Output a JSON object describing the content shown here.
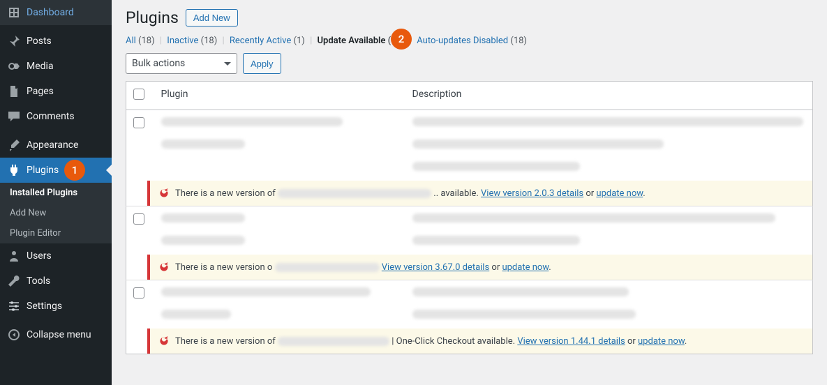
{
  "sidebar": {
    "items": [
      {
        "icon": "dashboard",
        "label": "Dashboard"
      },
      {
        "icon": "pin",
        "label": "Posts"
      },
      {
        "icon": "media",
        "label": "Media"
      },
      {
        "icon": "page",
        "label": "Pages"
      },
      {
        "icon": "comment",
        "label": "Comments"
      },
      {
        "icon": "appearance",
        "label": "Appearance"
      },
      {
        "icon": "plugin",
        "label": "Plugins"
      },
      {
        "icon": "users",
        "label": "Users"
      },
      {
        "icon": "tools",
        "label": "Tools"
      },
      {
        "icon": "settings",
        "label": "Settings"
      },
      {
        "icon": "collapse",
        "label": "Collapse menu"
      }
    ],
    "submenu": [
      {
        "label": "Installed Plugins"
      },
      {
        "label": "Add New"
      },
      {
        "label": "Plugin Editor"
      }
    ]
  },
  "header": {
    "title": "Plugins",
    "add_new": "Add New"
  },
  "filters": [
    {
      "label": "All",
      "count": "(18)",
      "current": false
    },
    {
      "label": "Inactive",
      "count": "(18)",
      "current": false
    },
    {
      "label": "Recently Active",
      "count": "(1)",
      "current": false
    },
    {
      "label": "Update Available",
      "count": "(18)",
      "current": true
    },
    {
      "label": "Auto-updates Disabled",
      "count": "(18)",
      "current": false
    }
  ],
  "bulk": {
    "label": "Bulk actions",
    "apply": "Apply"
  },
  "table": {
    "col_plugin": "Plugin",
    "col_description": "Description"
  },
  "rows": [
    {
      "notice_prefix": "There is a new version of",
      "notice_mid": ".. available. ",
      "view_details": "View version 2.0.3 details",
      "or_text": " or ",
      "update_now": "update now",
      "trail": "."
    },
    {
      "notice_prefix": "There is a new version o",
      "notice_mid": "",
      "view_details": "View version 3.67.0 details",
      "or_text": " or ",
      "update_now": "update now",
      "trail": "."
    },
    {
      "notice_prefix": "There is a new version of",
      "notice_mid": " | One-Click Checkout available. ",
      "view_details": "View version 1.44.1 details",
      "or_text": " or ",
      "update_now": "update now",
      "trail": "."
    }
  ],
  "annotations": {
    "badge1": "1",
    "badge2": "2"
  },
  "colors": {
    "accent": "#2271b1",
    "warn_border": "#d63638",
    "warn_bg": "#fcf9e8"
  }
}
